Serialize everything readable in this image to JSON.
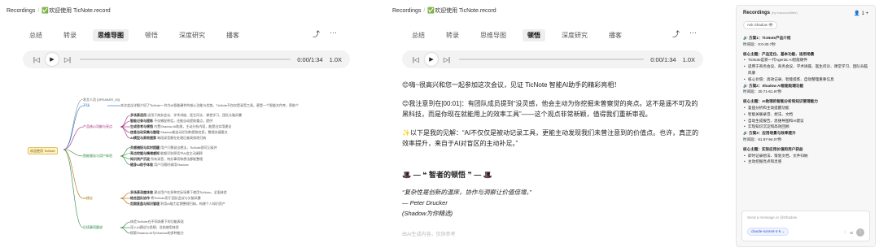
{
  "left": {
    "breadcrumb": {
      "root": "Recordings",
      "current": "✅欢迎使用 TicNote.record"
    },
    "tabs": [
      {
        "label": "总结"
      },
      {
        "label": "转录"
      },
      {
        "label": "思维导图"
      },
      {
        "label": "顿悟"
      },
      {
        "label": "深度研究"
      },
      {
        "label": "播客"
      }
    ],
    "active_tab": "思维导图",
    "player": {
      "time": "0:00/1:34",
      "speed": "1.0X",
      "progress": 0.0
    },
    "mindmap": {
      "root": "欢迎使用 TicNote",
      "speaker": "发言人员 [SPEAKER_00]",
      "branches": [
        {
          "label": "开场",
          "note": "本次会议详细介绍了TicNote一作为AI智能硬件的核心功能与优势。TicNote不仅仅是录音工具，更是一个智能文件库，帮助个"
        },
        {
          "label": "产品核心功能与亮点",
          "items": [
            {
              "k": "多场景适用",
              "v": "适用于商务会议、学术讲座、医生问诊、课堂学习、团队头脑风暴"
            },
            {
              "k": "智能记录与提炼",
              "v": "不仅捕捉原话，还能自动提炼重点，提供"
            },
            {
              "k": "生成思考与顿悟",
              "v": "内置Shadow AI助理，主动分析内容，能提出实用建议"
            },
            {
              "k": "信息自动采集与整理",
              "v": "Shadow能自动识别和提取信息，整理关键要点"
            },
            {
              "k": "AI模型与高效搜索",
              "v": "每段录音都在处理后被高效地归纳"
            }
          ]
        },
        {
          "label": "智能服务与用户体验",
          "items": [
            {
              "k": "灵感捕捉与实时提醒",
              "v": "用户只需说出想法，TicNote即可记录并"
            },
            {
              "k": "亮点挖掘与情绪感知",
              "v": "能够识别原话中AI会主动阐释"
            },
            {
              "k": "知识资产沉淀",
              "v": "所有录音、待办事项和想法都能整理"
            },
            {
              "k": "随身AI助手体验",
              "v": "用户可随时调用Shadow"
            }
          ]
        },
        {
          "label": "AI建议",
          "items": [
            {
              "k": "多场景深度体验",
              "v": "建议用户在多种实际场景下使用TicNote，全面体验"
            },
            {
              "k": "结合团队协作",
              "v": "将TicNote用于团队会议与头脑风暴"
            },
            {
              "k": "定期复盘与知识管理",
              "v": "利用AI能力定期整理归纳，构建个人知识资产"
            }
          ]
        },
        {
          "label": "后续事项跟进",
          "items": [
            {
              "k": "",
              "v": "体验TicNote在不同场景下的功能表现"
            },
            {
              "k": "",
              "v": "深入AI建议与思想，总结使用体验"
            },
            {
              "k": "",
              "v": "探索Shadow AI与Shadow的多种能力"
            }
          ]
        }
      ]
    }
  },
  "middle": {
    "breadcrumb": {
      "root": "Recordings",
      "current": "✅欢迎使用 TicNote.record"
    },
    "tabs": [
      {
        "label": "总结"
      },
      {
        "label": "转录"
      },
      {
        "label": "思维导图"
      },
      {
        "label": "顿悟"
      },
      {
        "label": "深度研究"
      },
      {
        "label": "播客"
      }
    ],
    "active_tab": "顿悟",
    "player": {
      "time": "0:00/1:34",
      "speed": "1.0X",
      "progress": 0.0
    },
    "paragraphs": [
      "😊嗨~很高兴和您一起参加这次会议，见证 TicNote 智能AI助手的精彩亮相！",
      "😊我注意到在[00:01]：有团队成员提到“没灵感，他会主动为你挖掘未曾察觉的亮点。这不是遥不可及的黑科技，而是你现在就能用上的效率工具”——这个观点非常新颖，值得我们重新审视。",
      "✨以下是我的见解：“AI不仅仅是被动记录工具，更能主动发现我们未曾注意到的价值点。也许，真正的效率提升，来自于AI对盲区的主动补足。”"
    ],
    "quote_title": "🎩 — ❝ 智者的顿悟 ❞ — 🎩",
    "quote_lines": [
      "“复杂性是创新的温床，协作与洞察让价值倍增。”",
      "— Peter Drucker",
      "(Shadow为你精选)"
    ],
    "footer_hint": "由AI生成内容，仅供参考"
  },
  "right": {
    "title": "Recordings",
    "subtitle": "(by eosoccarfilter)",
    "count": "1",
    "ask_pill": "Ask Shadow",
    "lines": [
      {
        "type": "h",
        "text": "🔊 方案1：TicNote产品介绍"
      },
      {
        "type": "p",
        "text": "时间段：0:0-30.7秒"
      },
      {
        "type": "gap"
      },
      {
        "type": "h",
        "text": "核心主题：产品定位、基本功能、适用场景"
      },
      {
        "type": "li",
        "text": "TicNote是新一代Agentic AI智能硬件"
      },
      {
        "type": "li",
        "text": "适用于商务会议、商务会议、学术讲座、医生问诊、课堂学习、团队头脑风暴"
      },
      {
        "type": "li",
        "text": "核心价值：高效记录、智能提炼、自动整理重要信息"
      },
      {
        "type": "h",
        "text": "🔊 方案2：Shadow AI智能助理功能"
      },
      {
        "type": "p",
        "text": "时间段：30.71-61.97秒"
      },
      {
        "type": "gap"
      },
      {
        "type": "h",
        "text": "核心主题：AI助理的智能分析和知识管理能力"
      },
      {
        "type": "li",
        "text": "复盘分析和主动提醒功能"
      },
      {
        "type": "li",
        "text": "智能关联录音、想法、文档"
      },
      {
        "type": "li",
        "text": "自动生成报告、思维导图和AI建议"
      },
      {
        "type": "li",
        "text": "实现知识沉淀和高效回顾"
      },
      {
        "type": "h",
        "text": "🔊 方案3：应用场景与效率提升"
      },
      {
        "type": "p",
        "text": "时间段：61.97-94.07秒"
      },
      {
        "type": "gap"
      },
      {
        "type": "h",
        "text": "核心主题：实际应用价值和用户获益"
      },
      {
        "type": "li",
        "text": "即时记录想法、策划文档、文件归纳"
      },
      {
        "type": "li",
        "text": "主动挖掘亮点和灵感"
      }
    ],
    "input_placeholder": "Send a message or @Shadow",
    "model": "claude-sonnet-4-5 ⌄"
  }
}
